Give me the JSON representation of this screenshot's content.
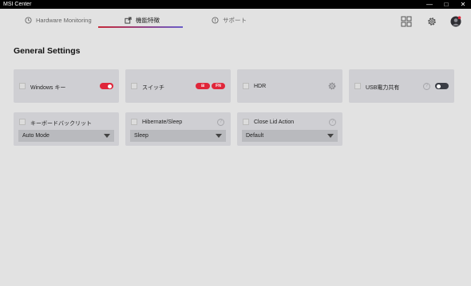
{
  "window": {
    "title": "MSI Center"
  },
  "tabs": [
    {
      "label": "Hardware Monitoring"
    },
    {
      "label": "機能特徴"
    },
    {
      "label": "サポート"
    }
  ],
  "page_title": "General Settings",
  "cards": {
    "windows_key": {
      "label": "Windows キー",
      "state": "on"
    },
    "switch": {
      "label": "スイッチ",
      "badges": [
        "⊞",
        "FN"
      ]
    },
    "hdr": {
      "label": "HDR"
    },
    "usb_power": {
      "label": "USB電力共有",
      "state": "off"
    },
    "keyboard_backlight": {
      "label": "キーボードバックリット",
      "value": "Auto Mode"
    },
    "hibernate_sleep": {
      "label": "Hibernate/Sleep",
      "value": "Sleep"
    },
    "close_lid": {
      "label": "Close Lid Action",
      "value": "Default"
    }
  },
  "icons": {
    "help": "?",
    "minimize": "—",
    "maximize": "□",
    "close": "✕"
  },
  "colors": {
    "accent": "#e0263a",
    "toggle_off": "#3a3d45",
    "card": "#cfcfd3",
    "background": "#e2e2e2"
  }
}
